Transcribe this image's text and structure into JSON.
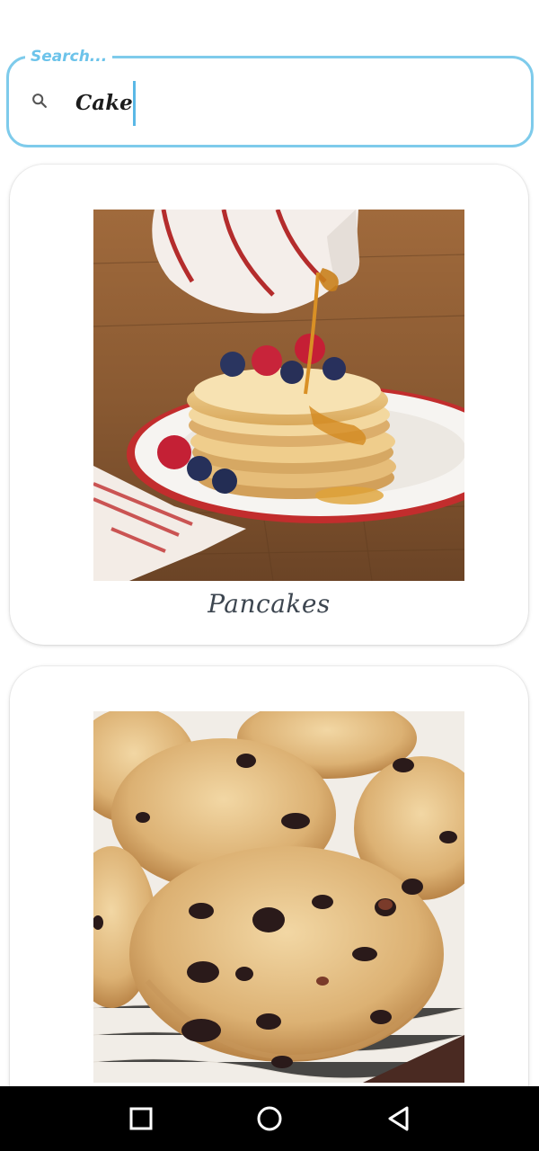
{
  "search": {
    "label": "Search...",
    "value": "Cake",
    "icon": "search-icon"
  },
  "recipes": [
    {
      "title": "Pancakes",
      "image": "pancakes-photo"
    },
    {
      "title": "",
      "image": "scones-photo"
    }
  ],
  "nav": {
    "recents_icon": "square-recents-icon",
    "home_icon": "circle-home-icon",
    "back_icon": "triangle-back-icon"
  },
  "colors": {
    "accent": "#7ecbeb",
    "title_text": "#3d4650",
    "nav_bg": "#000000"
  }
}
